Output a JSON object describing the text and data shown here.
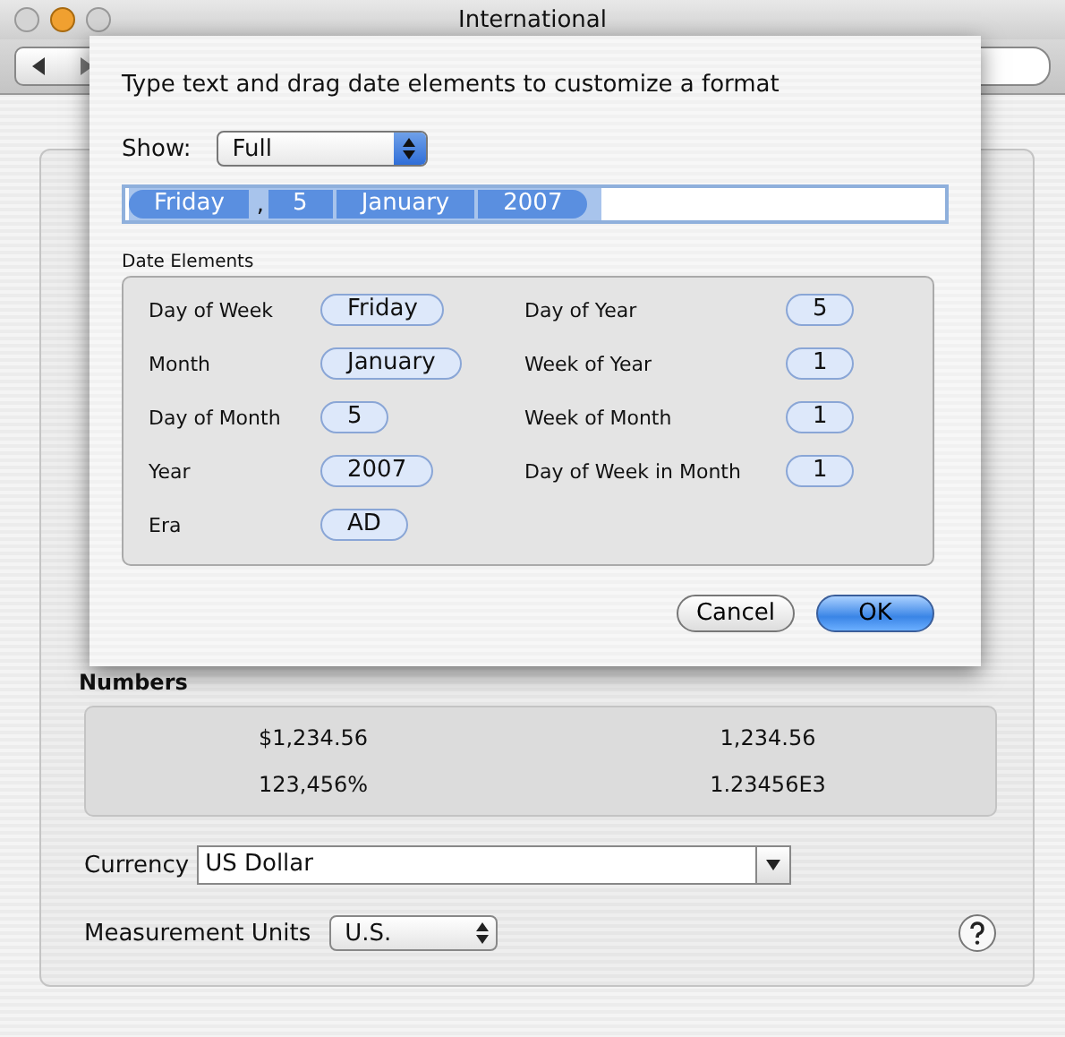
{
  "window": {
    "title": "International"
  },
  "sheet": {
    "instruction": "Type text and drag date elements to customize a format",
    "show_label": "Show:",
    "show_value": "Full",
    "tokens": [
      {
        "text": "Friday",
        "kind": "element"
      },
      {
        "text": ",",
        "kind": "literal"
      },
      {
        "text": "5",
        "kind": "element"
      },
      {
        "text": "January",
        "kind": "element"
      },
      {
        "text": "2007",
        "kind": "element"
      }
    ],
    "elements_title": "Date Elements",
    "left_elements": [
      {
        "label": "Day of Week",
        "value": "Friday"
      },
      {
        "label": "Month",
        "value": "January"
      },
      {
        "label": "Day of Month",
        "value": "5"
      },
      {
        "label": "Year",
        "value": "2007"
      },
      {
        "label": "Era",
        "value": "AD"
      }
    ],
    "right_elements": [
      {
        "label": "Day of Year",
        "value": "5"
      },
      {
        "label": "Week of Year",
        "value": "1"
      },
      {
        "label": "Week of Month",
        "value": "1"
      },
      {
        "label": "Day of Week in Month",
        "value": "1"
      }
    ],
    "buttons": [
      {
        "label": "Cancel",
        "kind": "normal"
      },
      {
        "label": "OK",
        "kind": "default"
      }
    ]
  },
  "numbers": {
    "title": "Numbers",
    "samples": [
      "$1,234.56",
      "1,234.56",
      "123,456%",
      "1.23456E3"
    ]
  },
  "currency": {
    "label": "Currency",
    "value": "US Dollar"
  },
  "measurement": {
    "label": "Measurement Units",
    "value": "U.S."
  }
}
